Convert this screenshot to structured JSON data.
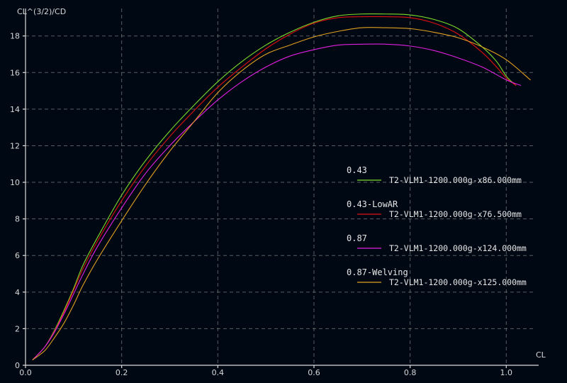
{
  "chart_data": {
    "type": "line",
    "ylabel": "CL^(3/2)/CD",
    "xlabel": "CL",
    "xlim": [
      0.0,
      1.06
    ],
    "ylim": [
      0,
      19.5
    ],
    "x_ticks": [
      "0.0",
      "0.2",
      "0.4",
      "0.6",
      "0.8",
      "1.0"
    ],
    "x_tick_values": [
      0.0,
      0.2,
      0.4,
      0.6,
      0.8,
      1.0
    ],
    "y_ticks": [
      "0",
      "2",
      "4",
      "6",
      "8",
      "10",
      "12",
      "14",
      "16",
      "18"
    ],
    "y_tick_values": [
      0,
      2,
      4,
      6,
      8,
      10,
      12,
      14,
      16,
      18
    ],
    "grid": true,
    "legend_position": "center-right",
    "series": [
      {
        "group": "0.43",
        "name": "T2-VLM1-1200.000g-x86.000mm",
        "color": "#7cdc2a",
        "x": [
          0.015,
          0.04,
          0.06,
          0.08,
          0.1,
          0.12,
          0.15,
          0.2,
          0.25,
          0.3,
          0.35,
          0.4,
          0.45,
          0.5,
          0.55,
          0.6,
          0.65,
          0.7,
          0.75,
          0.8,
          0.85,
          0.9,
          0.95,
          0.98,
          1.0,
          1.02
        ],
        "y": [
          0.3,
          1.0,
          1.9,
          3.0,
          4.2,
          5.5,
          7.0,
          9.3,
          11.2,
          12.8,
          14.2,
          15.5,
          16.6,
          17.5,
          18.2,
          18.75,
          19.1,
          19.2,
          19.2,
          19.15,
          18.9,
          18.4,
          17.4,
          16.6,
          15.8,
          15.3
        ]
      },
      {
        "group": "0.43-LowAR",
        "name": "T2-VLM1-1200.000g-x76.500mm",
        "color": "#e01010",
        "x": [
          0.015,
          0.04,
          0.06,
          0.08,
          0.1,
          0.12,
          0.15,
          0.2,
          0.25,
          0.3,
          0.35,
          0.4,
          0.45,
          0.5,
          0.55,
          0.6,
          0.65,
          0.7,
          0.75,
          0.8,
          0.85,
          0.9,
          0.95,
          0.98,
          1.0,
          1.02
        ],
        "y": [
          0.3,
          1.0,
          1.85,
          2.9,
          4.1,
          5.3,
          6.8,
          9.0,
          10.9,
          12.5,
          13.9,
          15.2,
          16.3,
          17.3,
          18.1,
          18.7,
          19.0,
          19.05,
          19.05,
          19.0,
          18.7,
          18.1,
          17.1,
          16.3,
          15.7,
          15.3
        ]
      },
      {
        "group": "0.87",
        "name": "T2-VLM1-1200.000g-x124.000mm",
        "color": "#e020e0",
        "x": [
          0.015,
          0.04,
          0.06,
          0.08,
          0.1,
          0.12,
          0.15,
          0.2,
          0.25,
          0.3,
          0.35,
          0.4,
          0.45,
          0.5,
          0.55,
          0.6,
          0.65,
          0.7,
          0.75,
          0.8,
          0.85,
          0.9,
          0.95,
          1.0,
          1.03
        ],
        "y": [
          0.3,
          1.0,
          1.8,
          2.8,
          3.9,
          5.0,
          6.5,
          8.6,
          10.5,
          12.0,
          13.3,
          14.5,
          15.5,
          16.3,
          16.9,
          17.25,
          17.5,
          17.55,
          17.55,
          17.45,
          17.2,
          16.8,
          16.3,
          15.6,
          15.3
        ]
      },
      {
        "group": "0.87-Welving",
        "name": "T2-VLM1-1200.000g-x125.000mm",
        "color": "#e0a020",
        "x": [
          0.015,
          0.04,
          0.06,
          0.08,
          0.1,
          0.12,
          0.15,
          0.2,
          0.25,
          0.3,
          0.35,
          0.4,
          0.45,
          0.5,
          0.55,
          0.6,
          0.65,
          0.7,
          0.75,
          0.8,
          0.85,
          0.9,
          0.95,
          1.0,
          1.05
        ],
        "y": [
          0.3,
          0.8,
          1.5,
          2.3,
          3.3,
          4.4,
          5.8,
          7.9,
          9.9,
          11.7,
          13.3,
          14.9,
          16.1,
          17.0,
          17.5,
          17.95,
          18.25,
          18.45,
          18.45,
          18.4,
          18.2,
          17.9,
          17.4,
          16.7,
          15.6
        ]
      }
    ]
  }
}
